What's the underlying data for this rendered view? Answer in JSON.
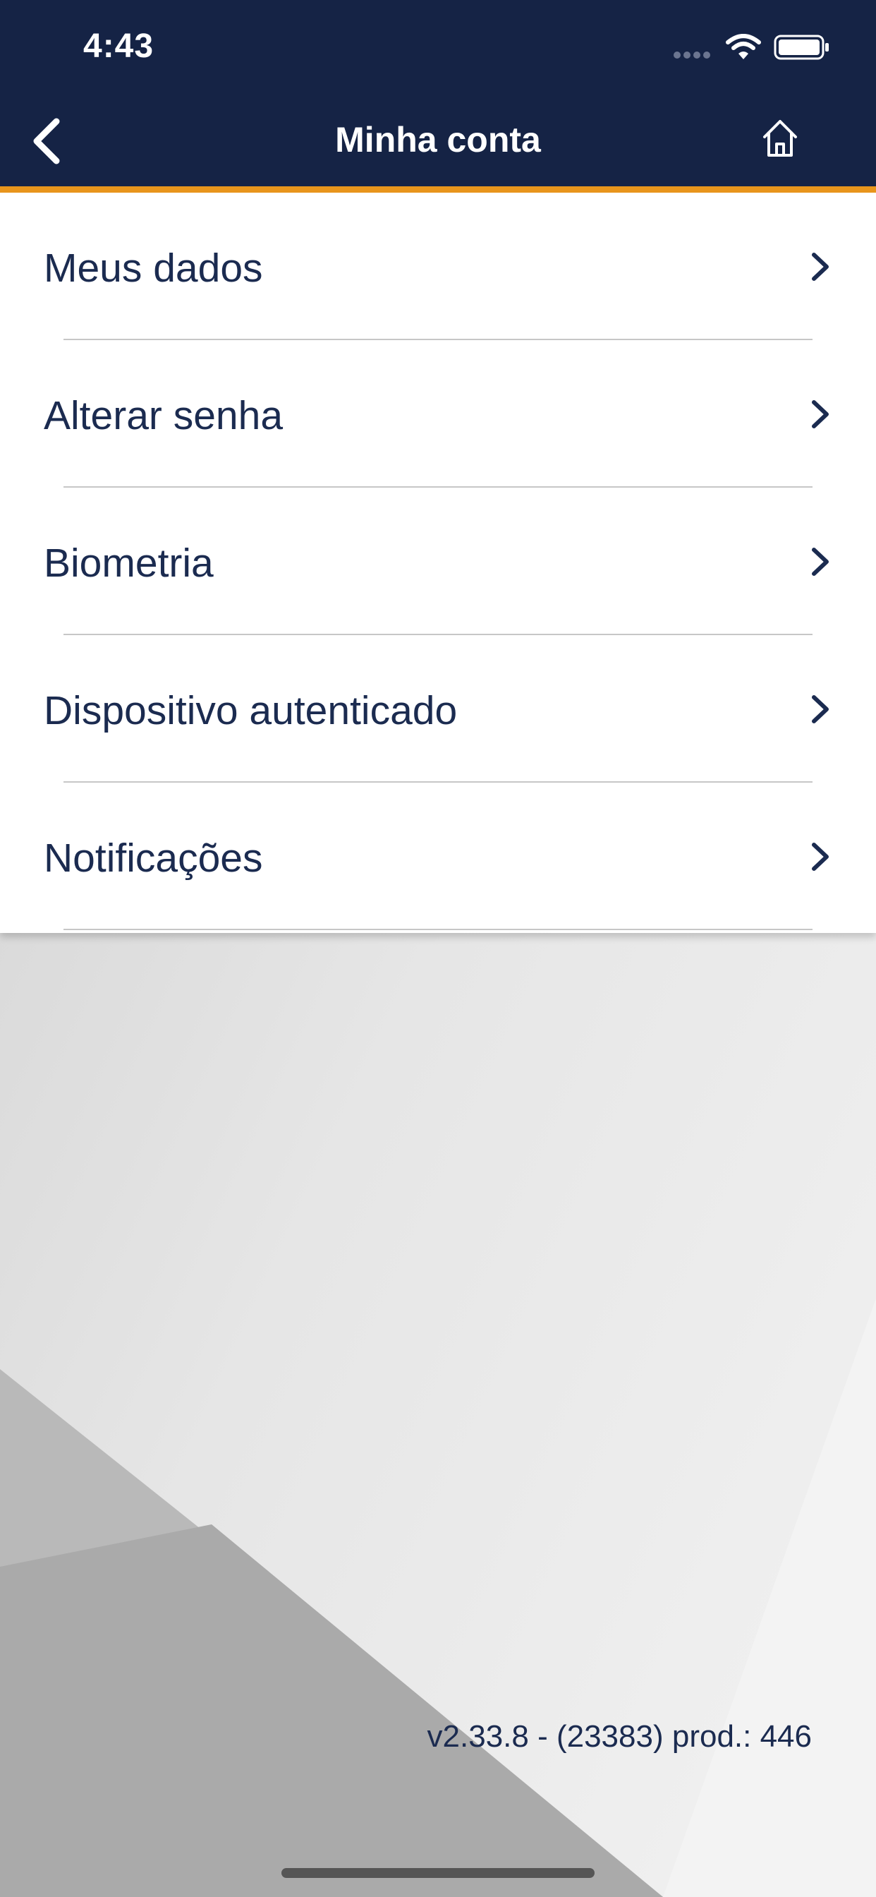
{
  "status_bar": {
    "time": "4:43",
    "wifi_icon": "wifi-icon",
    "battery_icon": "battery-icon"
  },
  "header": {
    "title": "Minha conta",
    "back_icon": "chevron-left-icon",
    "home_icon": "home-icon"
  },
  "menu": {
    "items": [
      {
        "label": "Meus dados"
      },
      {
        "label": "Alterar senha"
      },
      {
        "label": "Biometria"
      },
      {
        "label": "Dispositivo autenticado"
      },
      {
        "label": "Notificações"
      }
    ]
  },
  "footer": {
    "version": "v2.33.8 - (23383) prod.: 446"
  },
  "colors": {
    "header_bg": "#152345",
    "accent": "#e8951c",
    "text": "#1b2b50"
  }
}
